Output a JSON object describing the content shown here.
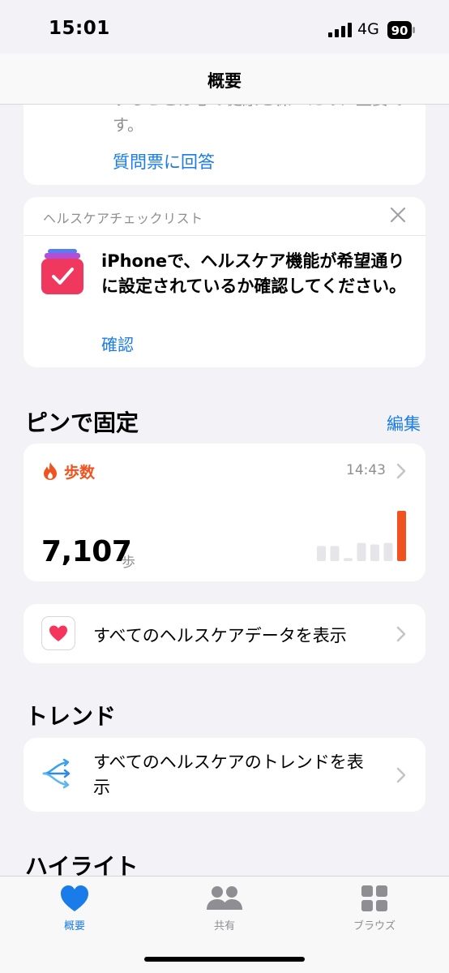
{
  "status_bar": {
    "time": "15:01",
    "network": "4G",
    "battery": "90"
  },
  "nav": {
    "title": "概要"
  },
  "questionnaire_card": {
    "body": "することは心の健康を保つために重要です。",
    "link": "質問票に回答"
  },
  "checklist_card": {
    "header": "ヘルスケアチェックリスト",
    "text": "iPhoneで、ヘルスケア機能が希望通りに設定されているか確認してください。",
    "link": "確認"
  },
  "pinned": {
    "title": "ピンで固定",
    "edit_label": "編集",
    "steps": {
      "label": "歩数",
      "time": "14:43",
      "value": "7,107",
      "unit": "歩",
      "chart_levels": [
        0.3,
        0.3,
        0.06,
        0.36,
        0.33,
        0.36,
        1.0
      ]
    },
    "all_data_label": "すべてのヘルスケアデータを表示"
  },
  "trends": {
    "title": "トレンド",
    "label": "すべてのヘルスケアのトレンドを表示"
  },
  "highlights": {
    "title": "ハイライト"
  },
  "tabbar": {
    "summary": "概要",
    "share": "共有",
    "browse": "ブラウズ"
  },
  "colors": {
    "accent": "#1a7ce8",
    "steps": "#f0531f",
    "bar_inactive": "#e5e5ea"
  },
  "icons": [
    "signal-icon",
    "battery-icon",
    "checklist-icon",
    "close-icon",
    "flame-icon",
    "chevron-right-icon",
    "heart-icon",
    "trend-arrows-icon",
    "heart-tab-icon",
    "people-icon",
    "grid-icon"
  ]
}
